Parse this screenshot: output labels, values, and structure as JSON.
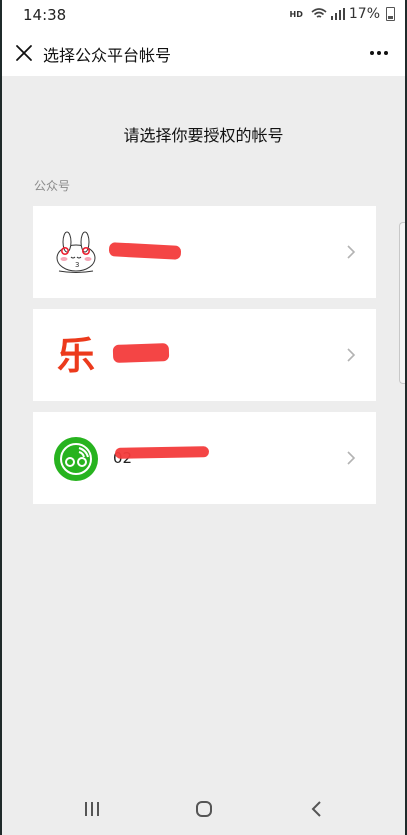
{
  "status_bar": {
    "time": "14:38",
    "network_label": "HD",
    "battery_text": "17%"
  },
  "header": {
    "title": "选择公众平台帐号",
    "close_icon": "close-icon",
    "more_icon": "more-icon"
  },
  "main": {
    "prompt": "请选择你要授权的帐号",
    "section_label": "公众号",
    "accounts": [
      {
        "avatar_icon": "bunny-avatar",
        "name": ""
      },
      {
        "avatar_icon": "le-logo",
        "avatar_text": "乐",
        "name": ""
      },
      {
        "avatar_icon": "green-circle-logo",
        "name": "02"
      }
    ]
  },
  "nav_bar": {
    "recent_icon": "recent-apps-icon",
    "home_icon": "home-icon",
    "back_icon": "back-icon"
  },
  "colors": {
    "background": "#ededed",
    "card": "#ffffff",
    "redaction": "#f33b3b",
    "le_logo": "#ec3a1c",
    "green_logo": "#27b31f"
  }
}
